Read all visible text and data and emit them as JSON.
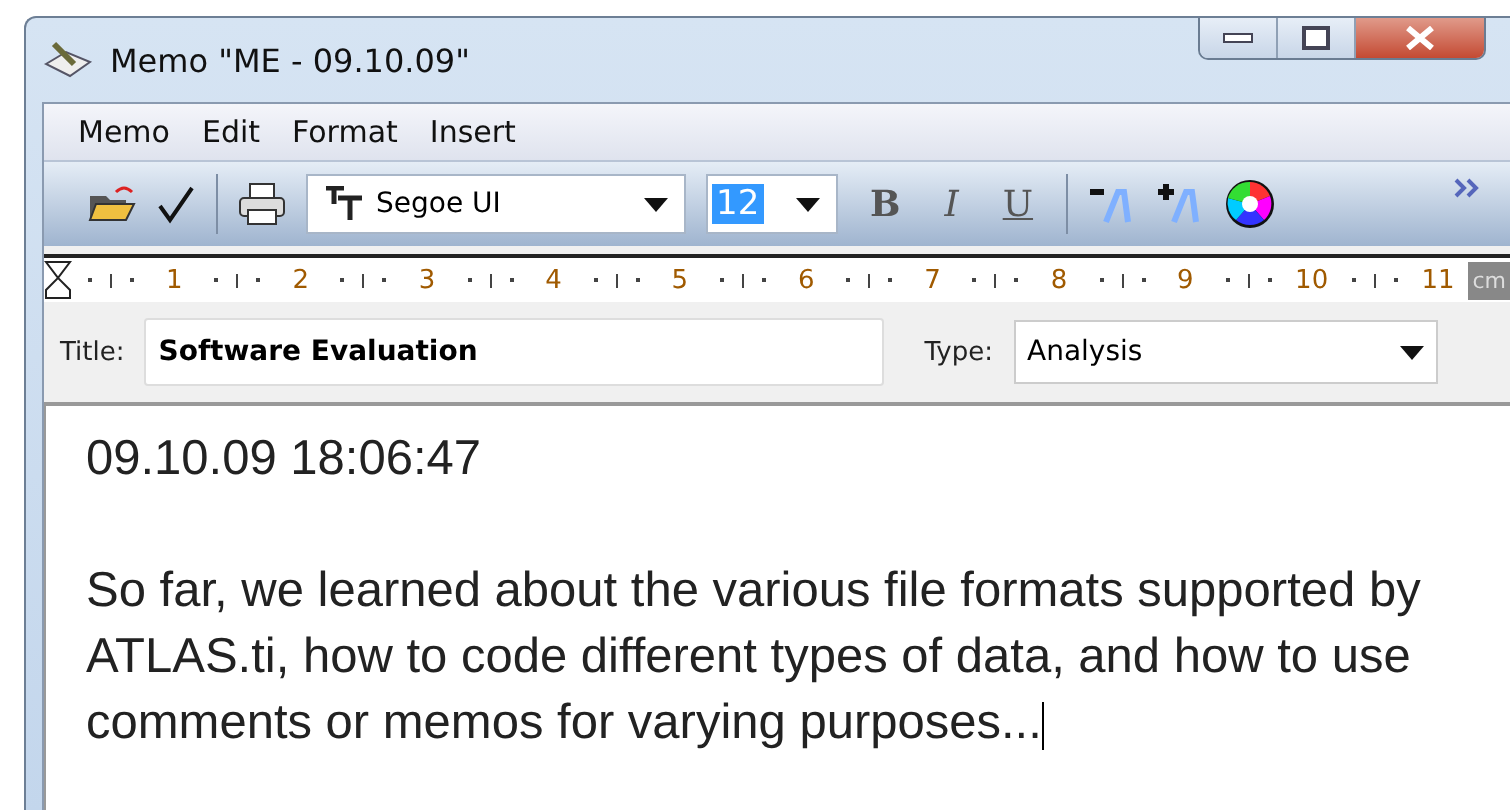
{
  "window": {
    "title": "Memo \"ME - 09.10.09\""
  },
  "menu": [
    "Memo",
    "Edit",
    "Format",
    "Insert"
  ],
  "toolbar": {
    "font": "Segoe UI",
    "size": "12",
    "format_buttons": [
      {
        "label": "B",
        "kind": "bold"
      },
      {
        "label": "I",
        "kind": "italic"
      },
      {
        "label": "U",
        "kind": "underline"
      }
    ]
  },
  "ruler": {
    "numbers": [
      "1",
      "2",
      "3",
      "4",
      "5",
      "6",
      "7",
      "8",
      "9",
      "10",
      "11"
    ],
    "unit": "cm"
  },
  "title_field": {
    "label": "Title:",
    "value": "Software Evaluation"
  },
  "type_field": {
    "label": "Type:",
    "value": "Analysis"
  },
  "body": {
    "timestamp": "09.10.09 18:06:47",
    "lines": [
      "So far, we learned about the various file formats supported by",
      "ATLAS.ti, how to code different types of data, and how to use",
      "comments or memos for varying purposes..."
    ]
  }
}
